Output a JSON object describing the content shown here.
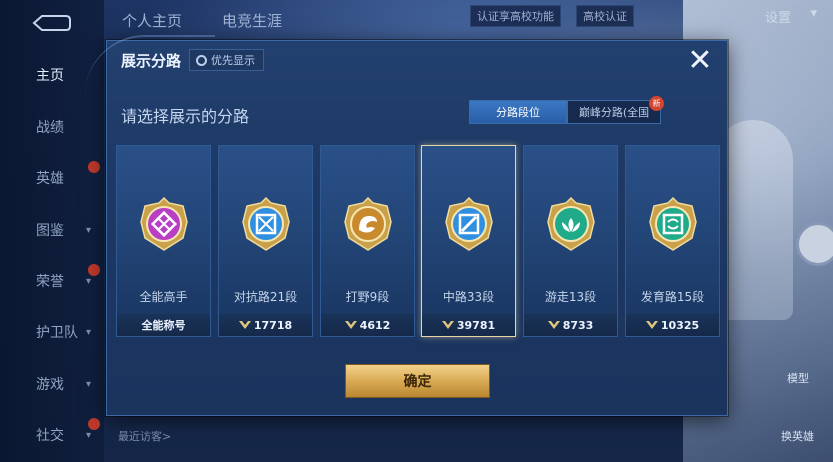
{
  "sidebar": {
    "items": [
      {
        "label": "主页",
        "active": true
      },
      {
        "label": "战绩"
      },
      {
        "label": "英雄",
        "new": true
      },
      {
        "label": "图鉴",
        "chevron": true
      },
      {
        "label": "荣誉",
        "chevron": true,
        "new": true
      },
      {
        "label": "护卫队",
        "chevron": true
      },
      {
        "label": "游戏",
        "chevron": true
      },
      {
        "label": "社交",
        "chevron": true,
        "new": true
      }
    ]
  },
  "topbar": {
    "tabs": [
      "个人主页",
      "电竞生涯"
    ],
    "certify_label": "认证享高校功能",
    "campus_label": "高校认证",
    "settings_label": "设置"
  },
  "bottombar": {
    "visitors_label": "最近访客>",
    "model_label": "模型",
    "swap_hero_label": "换英雄"
  },
  "modal": {
    "title": "展示分路",
    "priority_label": "优先显示",
    "subtitle": "请选择展示的分路",
    "tabs": [
      {
        "label": "分路段位",
        "active": true
      },
      {
        "label": "巅峰分路(全国",
        "new_badge": "新"
      }
    ],
    "cards": [
      {
        "name": "全能高手",
        "foot": "全能称号",
        "badge_color": "#b83fc4",
        "symbol": "all"
      },
      {
        "name": "对抗路21段",
        "points": "17718",
        "badge_color": "#2f8fe0",
        "symbol": "clash"
      },
      {
        "name": "打野9段",
        "points": "4612",
        "badge_color": "#c98a2e",
        "symbol": "jungle"
      },
      {
        "name": "中路33段",
        "points": "39781",
        "badge_color": "#2f8fe0",
        "symbol": "mid",
        "selected": true
      },
      {
        "name": "游走13段",
        "points": "8733",
        "badge_color": "#1faa8a",
        "symbol": "roam"
      },
      {
        "name": "发育路15段",
        "points": "10325",
        "badge_color": "#1faa8a",
        "symbol": "farm"
      }
    ],
    "confirm_label": "确定"
  },
  "icons": {
    "back": "back-arrow-icon",
    "close": "close-icon",
    "gear": "gear-icon",
    "points": "points-chevron-icon"
  }
}
